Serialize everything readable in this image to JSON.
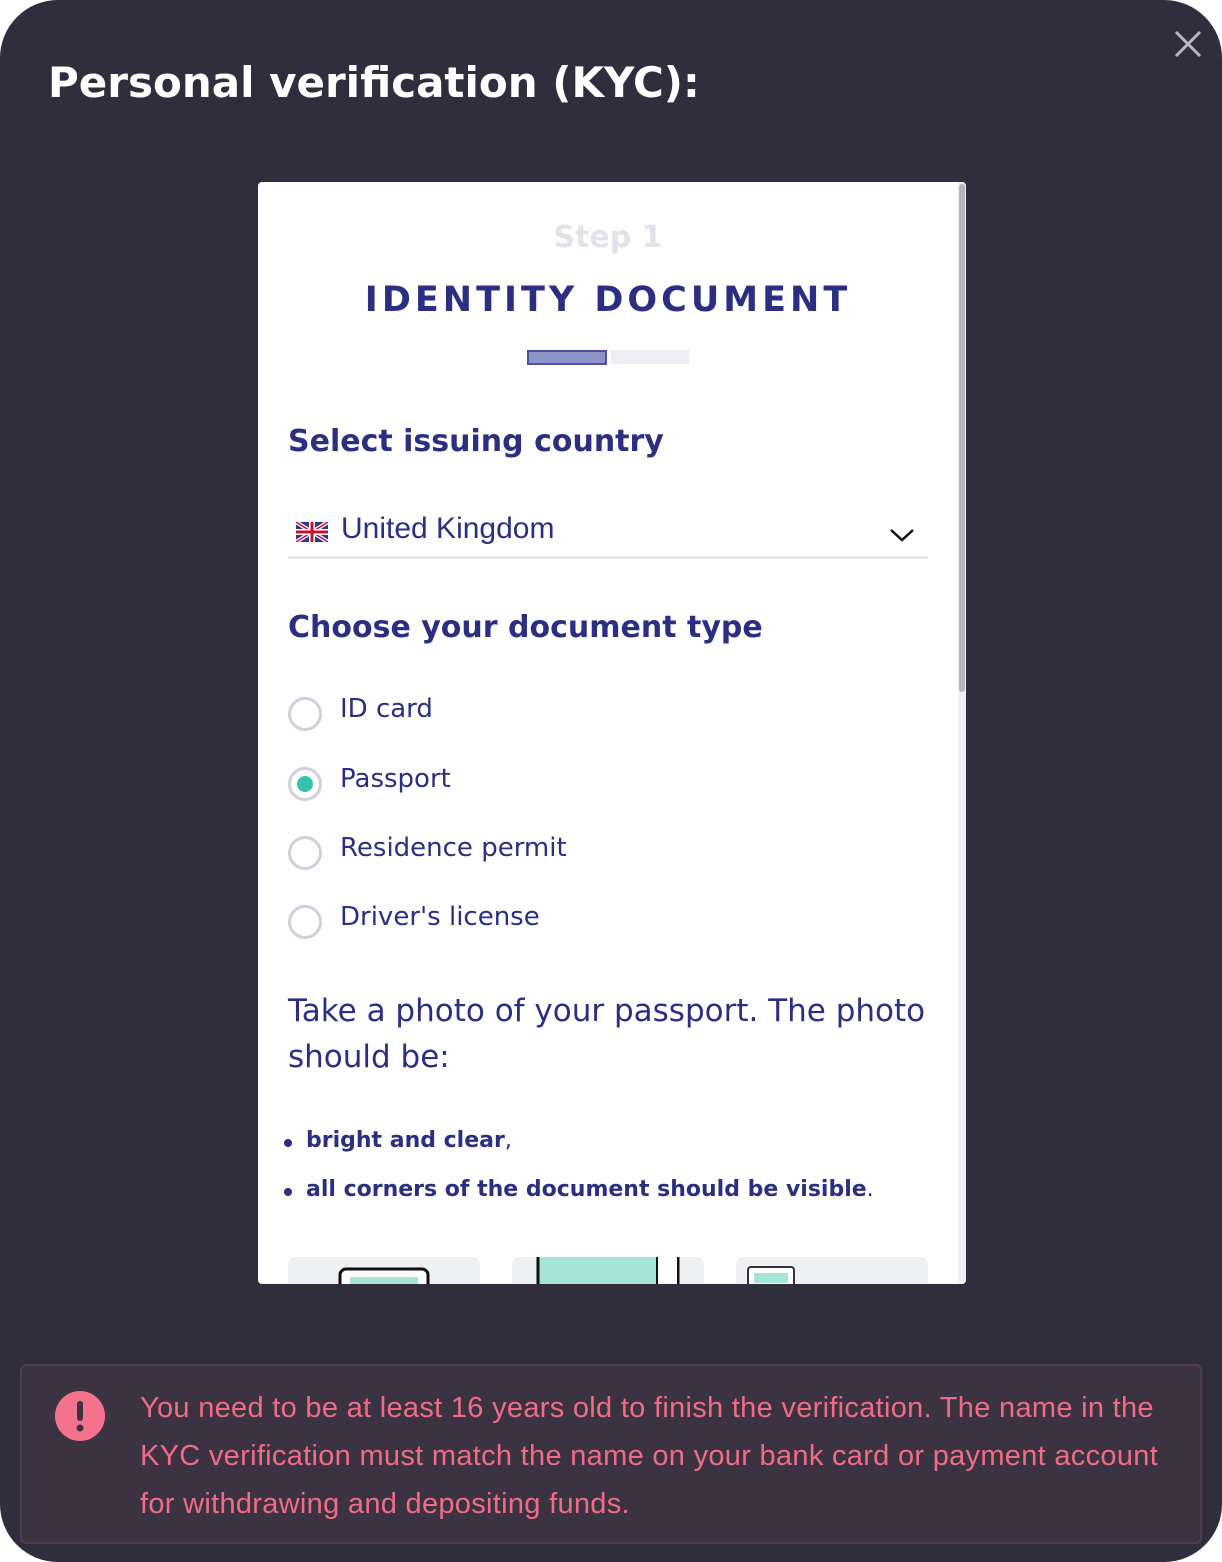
{
  "modal": {
    "title": "Personal verification (KYC):",
    "close_icon": "close-icon"
  },
  "step": {
    "label": "Step 1",
    "title": "IDENTITY DOCUMENT",
    "progress": {
      "current": 1,
      "total": 2
    }
  },
  "country": {
    "heading": "Select issuing country",
    "selected": "United Kingdom",
    "flag_icon": "uk-flag-icon",
    "chevron_icon": "chevron-down-icon"
  },
  "document_type": {
    "heading": "Choose your document type",
    "options": [
      {
        "label": "ID card",
        "checked": false
      },
      {
        "label": "Passport",
        "checked": true
      },
      {
        "label": "Residence permit",
        "checked": false
      },
      {
        "label": "Driver's license",
        "checked": false
      }
    ]
  },
  "instructions": {
    "text": "Take a photo of your passport. The photo should be:",
    "bullets": [
      {
        "bold": "bright and clear",
        "tail": ","
      },
      {
        "bold": "all corners of the document should be visible",
        "tail": "."
      }
    ]
  },
  "notice": {
    "icon": "exclamation-icon",
    "text": "You need to be at least 16 years old to finish the verification. The name in the KYC verification must match the name on your bank card or payment account for withdrawing and depositing funds."
  },
  "colors": {
    "modal_bg": "#302e3c",
    "accent_navy": "#2b2f80",
    "radio_checked": "#36c1b3",
    "notice_text": "#f06c84",
    "notice_icon": "#f5728c"
  }
}
